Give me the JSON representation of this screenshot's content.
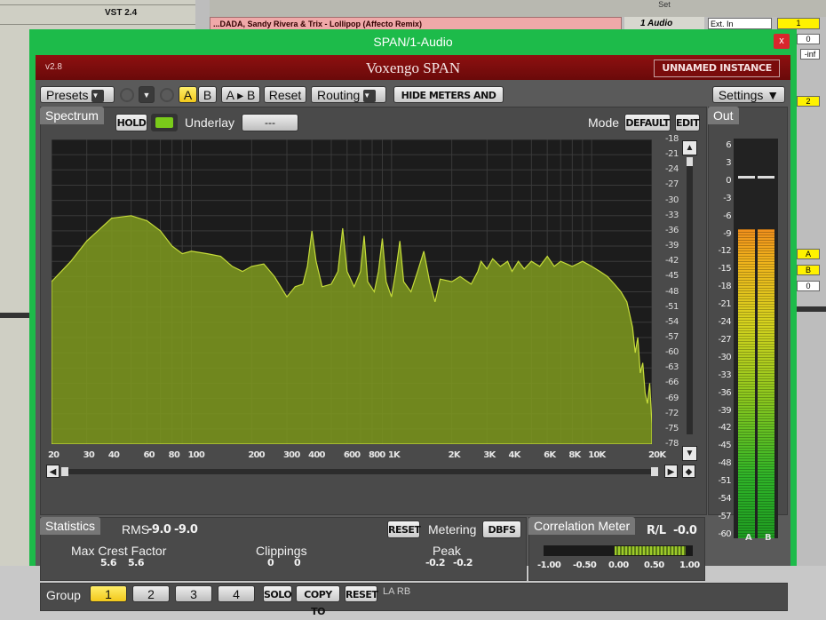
{
  "daw": {
    "track_label": "VST 2.4",
    "clip_name": "...DADA, Sandy Rivera & Trix - Lollipop (Affecto Remix)",
    "audio_track": "1 Audio",
    "input": "Ext. In",
    "set_label": "Set",
    "track_number": "1",
    "inf_label": "-inf",
    "track_number_2": "2",
    "ab_labels": [
      "A",
      "B",
      "0"
    ]
  },
  "window": {
    "title": "SPAN/1-Audio",
    "close": "x"
  },
  "plugin": {
    "version": "v2.8",
    "product": "Voxengo SPAN",
    "instance": "UNNAMED INSTANCE"
  },
  "toolbar": {
    "presets": "Presets",
    "a": "A",
    "b": "B",
    "atob": "A ▸ B",
    "reset": "Reset",
    "routing": "Routing",
    "hide_meters": "HIDE METERS AND STATS",
    "settings": "Settings ▼"
  },
  "spectrum": {
    "tab": "Spectrum",
    "hold": "HOLD",
    "underlay_label": "Underlay",
    "underlay_value": "---",
    "mode_label": "Mode",
    "mode_value": "DEFAULT",
    "edit": "EDIT",
    "db_ticks": [
      "-18",
      "-21",
      "-24",
      "-27",
      "-30",
      "-33",
      "-36",
      "-39",
      "-42",
      "-45",
      "-48",
      "-51",
      "-54",
      "-57",
      "-60",
      "-63",
      "-66",
      "-69",
      "-72",
      "-75",
      "-78"
    ],
    "freq_ticks": [
      "20",
      "30",
      "40",
      "60",
      "80",
      "100",
      "200",
      "300",
      "400",
      "600",
      "800",
      "1K",
      "2K",
      "3K",
      "4K",
      "6K",
      "8K",
      "10K",
      "20K"
    ]
  },
  "out_meter": {
    "tab": "Out",
    "ticks": [
      "6",
      "3",
      "0",
      "-3",
      "-6",
      "-9",
      "-12",
      "-15",
      "-18",
      "-21",
      "-24",
      "-27",
      "-30",
      "-33",
      "-36",
      "-39",
      "-42",
      "-45",
      "-48",
      "-51",
      "-54",
      "-57",
      "-60"
    ],
    "channels": [
      "A",
      "B"
    ],
    "level_a_db": -9,
    "level_b_db": -9,
    "peak_a_db": -0.2,
    "peak_b_db": -0.2
  },
  "statistics": {
    "tab": "Statistics",
    "rms_label": "RMS",
    "rms_a": "-9.0",
    "rms_b": "-9.0",
    "reset": "RESET",
    "metering_label": "Metering",
    "metering_value": "DBFS",
    "crest_label": "Max Crest Factor",
    "crest_a": "5.6",
    "crest_b": "5.6",
    "clip_label": "Clippings",
    "clip_a": "0",
    "clip_b": "0",
    "peak_label": "Peak",
    "peak_a": "-0.2",
    "peak_b": "-0.2"
  },
  "correlation": {
    "tab": "Correlation Meter",
    "rl_label": "R/L",
    "rl_value": "-0.0",
    "ticks": [
      "-1.00",
      "-0.50",
      "0.00",
      "0.50",
      "1.00"
    ]
  },
  "group": {
    "label": "Group",
    "buttons": [
      "1",
      "2",
      "3",
      "4"
    ],
    "solo": "SOLO",
    "copy_to": "COPY TO",
    "reset": "RESET",
    "lr": "LA RB"
  },
  "colors": {
    "accent_green": "#1dbb4a",
    "brand_red": "#8e1010",
    "spectrum_fill": "#7f9a1e",
    "button_yellow": "#f2c81b"
  }
}
